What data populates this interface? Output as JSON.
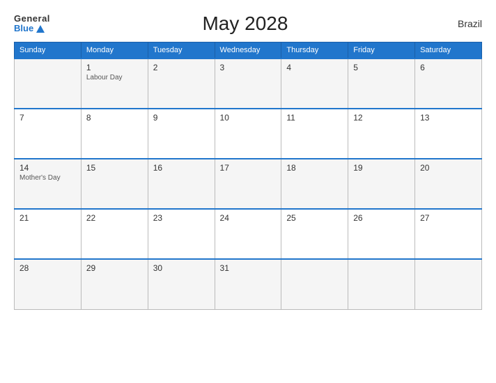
{
  "header": {
    "logo_general": "General",
    "logo_blue": "Blue",
    "title": "May 2028",
    "country": "Brazil"
  },
  "weekdays": [
    "Sunday",
    "Monday",
    "Tuesday",
    "Wednesday",
    "Thursday",
    "Friday",
    "Saturday"
  ],
  "weeks": [
    [
      {
        "day": "",
        "event": ""
      },
      {
        "day": "1",
        "event": "Labour Day"
      },
      {
        "day": "2",
        "event": ""
      },
      {
        "day": "3",
        "event": ""
      },
      {
        "day": "4",
        "event": ""
      },
      {
        "day": "5",
        "event": ""
      },
      {
        "day": "6",
        "event": ""
      }
    ],
    [
      {
        "day": "7",
        "event": ""
      },
      {
        "day": "8",
        "event": ""
      },
      {
        "day": "9",
        "event": ""
      },
      {
        "day": "10",
        "event": ""
      },
      {
        "day": "11",
        "event": ""
      },
      {
        "day": "12",
        "event": ""
      },
      {
        "day": "13",
        "event": ""
      }
    ],
    [
      {
        "day": "14",
        "event": "Mother's Day"
      },
      {
        "day": "15",
        "event": ""
      },
      {
        "day": "16",
        "event": ""
      },
      {
        "day": "17",
        "event": ""
      },
      {
        "day": "18",
        "event": ""
      },
      {
        "day": "19",
        "event": ""
      },
      {
        "day": "20",
        "event": ""
      }
    ],
    [
      {
        "day": "21",
        "event": ""
      },
      {
        "day": "22",
        "event": ""
      },
      {
        "day": "23",
        "event": ""
      },
      {
        "day": "24",
        "event": ""
      },
      {
        "day": "25",
        "event": ""
      },
      {
        "day": "26",
        "event": ""
      },
      {
        "day": "27",
        "event": ""
      }
    ],
    [
      {
        "day": "28",
        "event": ""
      },
      {
        "day": "29",
        "event": ""
      },
      {
        "day": "30",
        "event": ""
      },
      {
        "day": "31",
        "event": ""
      },
      {
        "day": "",
        "event": ""
      },
      {
        "day": "",
        "event": ""
      },
      {
        "day": "",
        "event": ""
      }
    ]
  ]
}
